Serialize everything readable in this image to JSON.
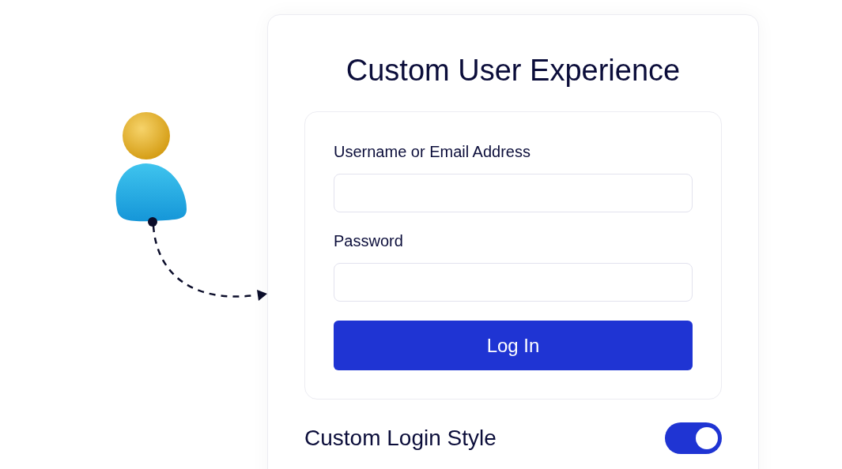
{
  "card": {
    "title": "Custom User Experience"
  },
  "login_form": {
    "fields": [
      {
        "label": "Username or Email Address"
      },
      {
        "label": "Password"
      }
    ],
    "submit_button": "Log In"
  },
  "settings": [
    {
      "label": "Custom Login Style",
      "on": true
    }
  ]
}
